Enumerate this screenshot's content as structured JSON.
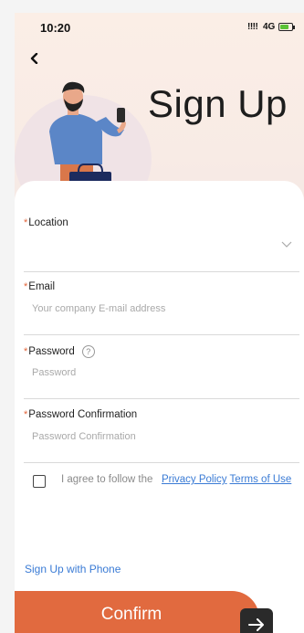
{
  "status_bar": {
    "time": "10:20",
    "signal": "!!!!",
    "network": "4G"
  },
  "header": {
    "title": "Sign Up"
  },
  "form": {
    "location": {
      "label": "Location",
      "value": ""
    },
    "email": {
      "label": "Email",
      "placeholder": "Your company E-mail address"
    },
    "password": {
      "label": "Password",
      "placeholder": "Password"
    },
    "password_confirmation": {
      "label": "Password Confirmation",
      "placeholder": "Password Confirmation"
    },
    "required_mark": "*",
    "help_icon_glyph": "?"
  },
  "agreement": {
    "text": "I agree to follow the",
    "privacy_link": "Privacy Policy",
    "terms_link": "Terms of Use"
  },
  "alt_signup": {
    "label": "Sign Up with Phone"
  },
  "actions": {
    "confirm_label": "Confirm"
  },
  "colors": {
    "accent": "#e16a3f",
    "link": "#3a7bd5",
    "hero_bg": "#fbeee6"
  },
  "icons": [
    "back-icon",
    "help-icon",
    "chevron-down-icon",
    "arrow-right-icon",
    "battery-icon"
  ]
}
